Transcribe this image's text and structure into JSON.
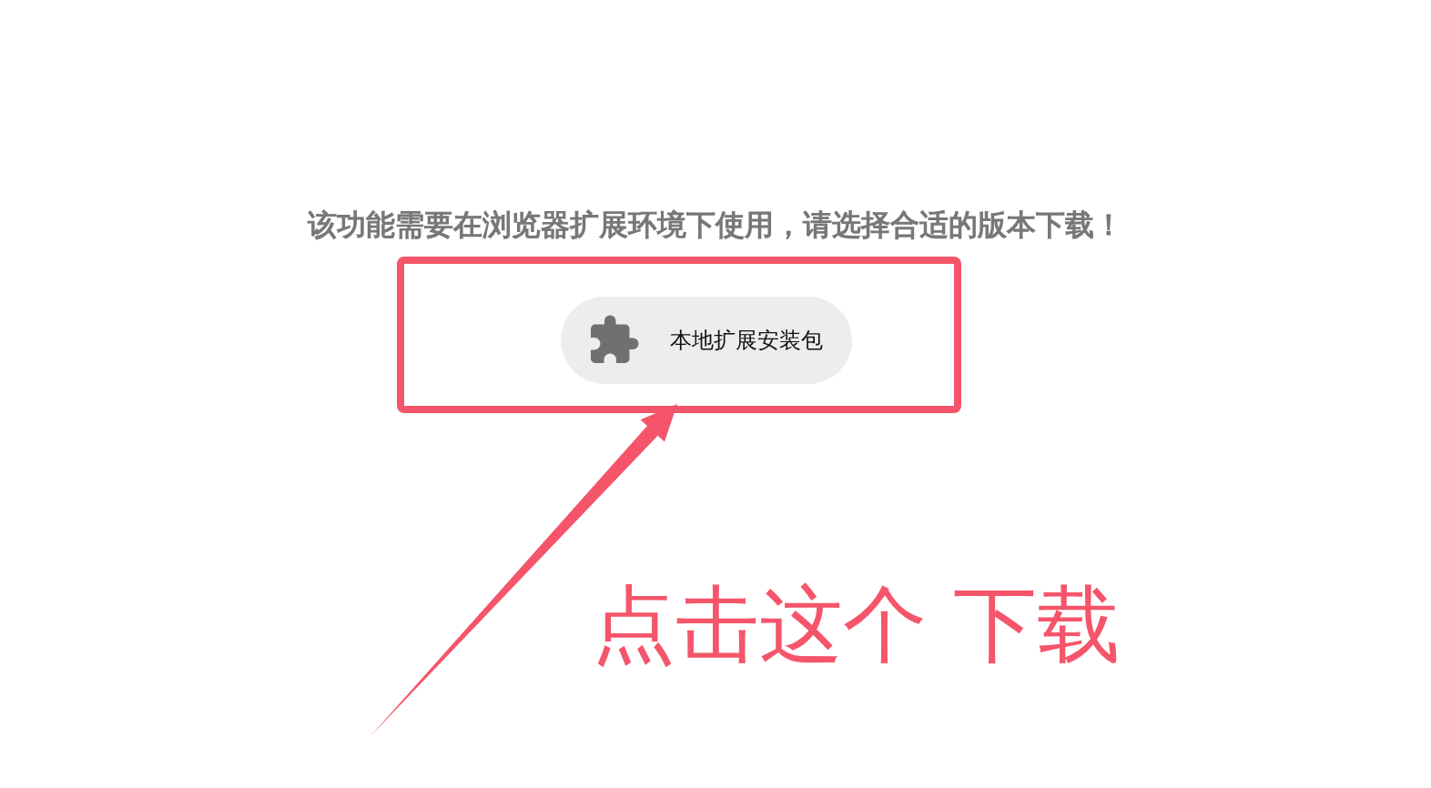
{
  "message": "该功能需要在浏览器扩展环境下使用，请选择合适的版本下载！",
  "download_button": {
    "label": "本地扩展安装包"
  },
  "annotation": {
    "caption": "点击这个 下载"
  }
}
